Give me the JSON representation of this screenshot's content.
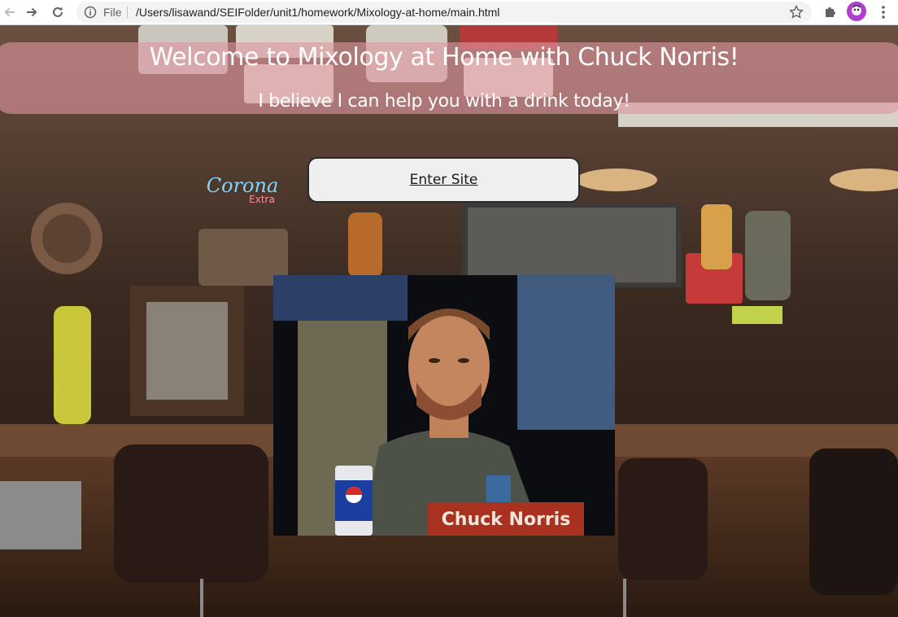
{
  "browser": {
    "scheme_label": "File",
    "url": "/Users/lisawand/SEIFolder/unit1/homework/Mixology-at-home/main.html",
    "icons": {
      "back": "back-arrow-icon",
      "forward": "forward-arrow-icon",
      "reload": "reload-icon",
      "info": "info-icon",
      "bookmark": "star-icon",
      "extensions": "puzzle-icon",
      "profile": "avatar",
      "menu": "kebab-menu-icon"
    }
  },
  "header": {
    "title": "Welcome to Mixology at Home with Chuck Norris!",
    "subtitle": "I believe I can help you with a drink today!"
  },
  "enter_button": {
    "label": "Enter Site"
  },
  "gif": {
    "caption": "Chuck Norris"
  },
  "colors": {
    "banner": "#de96a0",
    "button_bg": "#efefef",
    "nameplate": "#a8321f"
  }
}
